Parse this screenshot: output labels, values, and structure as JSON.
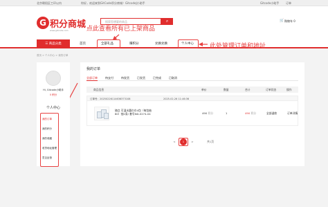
{
  "topbar": {
    "location": "北京朝阳区工环以内",
    "greeting": "你好，欢迎来到GitCode积分商城！GitcodeJ小助手",
    "right_links": [
      "Gitcode小助手",
      "订单",
      "|"
    ]
  },
  "header": {
    "logo_letter": "G",
    "logo_text": "积分商城",
    "logo_sub": "www.gitcode.com",
    "search_placeholder": "搜索您想要的商品",
    "search_icon": "search-icon",
    "cart_label": "购物车 0",
    "cart_icon": "cart-icon"
  },
  "annotations": {
    "view_all": "点此查看所有已上架商品",
    "manage": "此处管理订单和地址"
  },
  "nav": {
    "category": "商品分类",
    "items": [
      "首页",
      "全部礼品",
      "赚积分",
      "兑换兑换",
      "个人中心"
    ]
  },
  "breadcrumb": "首页 > 个人中心 > 我的订单",
  "sidebar": {
    "username": "Hi, Gitcode小助手",
    "points": "0 积分",
    "title": "个人中心",
    "menu": [
      "我的订单",
      "我的积分",
      "我的收藏",
      "收货地址管理",
      "意见反馈"
    ]
  },
  "main": {
    "title": "我的订单",
    "tabs": [
      "全部订单",
      "待支付",
      "待发货",
      "已发货",
      "已完成",
      "已取消"
    ],
    "columns": [
      "商品信息",
      "单价",
      "数量",
      "合计",
      "订单状态",
      "操作"
    ],
    "order": {
      "number": "订单号：20250226114636373108",
      "time": "2025-02-26 11:46:36",
      "product_name": "随点 可温水圆巾巾4包（每包抽80）抽1条/ 套号ND-0274-04",
      "unit_price": "490",
      "unit_label": "积分",
      "quantity": "1",
      "total": "490",
      "status": "全部退款",
      "action": "订单详情"
    },
    "pager": {
      "prev": "<",
      "current": "1",
      "next": ">",
      "total_text": "共1页"
    }
  },
  "colors": {
    "brand": "#e02d2d",
    "annotation": "#e84141"
  }
}
